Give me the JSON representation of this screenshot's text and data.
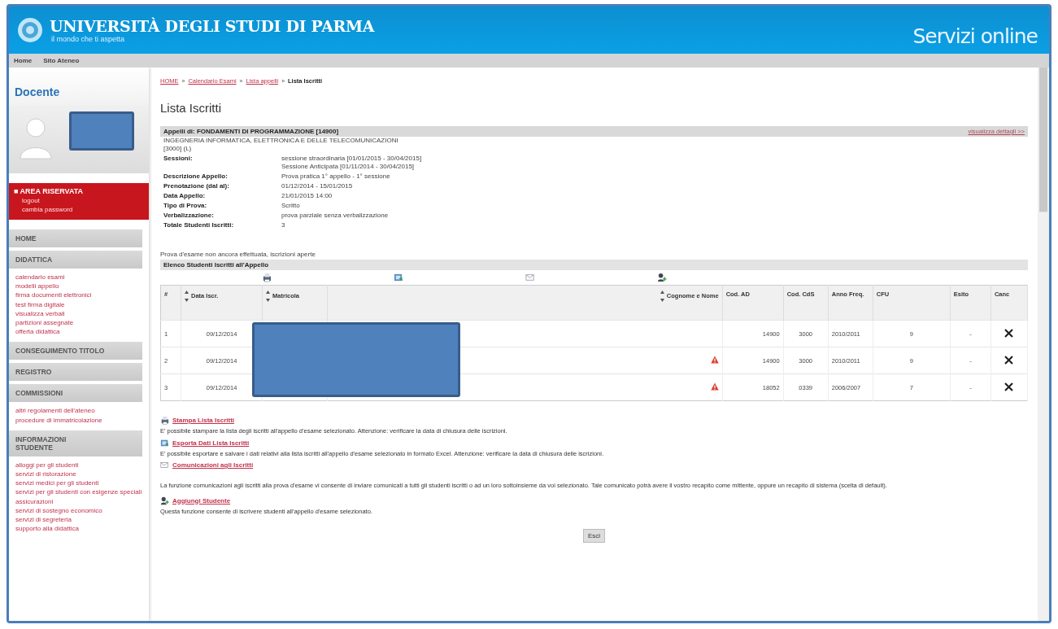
{
  "header": {
    "title": "UNIVERSITÀ DEGLI STUDI DI PARMA",
    "tagline": "il mondo che ti aspetta",
    "service": "Servizi online"
  },
  "nav": [
    "Home",
    "Sito Ateneo"
  ],
  "sidebar": {
    "title": "Docente",
    "profile": {
      "redacted": true
    },
    "reserved": {
      "bullet": "■",
      "title": "AREA RISERVATA",
      "links": [
        "logout",
        "cambia password"
      ]
    },
    "sections": [
      {
        "title": "HOME"
      },
      {
        "title": "DIDATTICA",
        "links": [
          "calendario esami",
          "modelli appello",
          "firma documenti elettronici",
          "test firma digitale",
          "visualizza verbali",
          "partizioni assegnate",
          "offerta didattica"
        ]
      },
      {
        "title": "CONSEGUIMENTO TITOLO"
      },
      {
        "title": "REGISTRO"
      },
      {
        "title": "COMMISSIONI",
        "links": [
          "altri regolamenti dell'ateneo",
          "procedure di immatricolazione"
        ]
      },
      {
        "title": "INFORMAZIONI STUDENTE",
        "links": [
          "alloggi per gli studenti",
          "servizi di ristorazione",
          "servizi medici per gli studenti",
          "servizi per gli studenti con esigenze speciali",
          "assicurazioni",
          "servizi di sostegno economico",
          "servizi di segreteria",
          "supporto alla didattica"
        ]
      }
    ]
  },
  "breadcrumb_separator": "»",
  "breadcrumb": [
    {
      "label": "HOME",
      "link": true
    },
    {
      "label": "Calendario Esami",
      "link": true
    },
    {
      "label": "Lista appelli",
      "link": true
    },
    {
      "label": "Lista Iscritti",
      "link": false
    }
  ],
  "page_title": "Lista Iscritti",
  "appello": {
    "title": "Appelli di: FONDAMENTI DI PROGRAMMAZIONE [14900]",
    "details_link": "visualizza dettagli >>",
    "course": "INGEGNERIA INFORMATICA, ELETTRONICA E DELLE TELECOMUNICAZIONI [3000] (L)",
    "fields": [
      {
        "label": "Sessioni:",
        "values": [
          "sessione straordinaria [01/01/2015 - 30/04/2015]",
          "Sessione Anticipata [01/11/2014 - 30/04/2015]"
        ]
      },
      {
        "label": "Descrizione Appello:",
        "values": [
          "Prova pratica 1° appello - 1° sessione"
        ]
      },
      {
        "label": "Prenotazione (dal al):",
        "values": [
          "01/12/2014 - 15/01/2015"
        ]
      },
      {
        "label": "Data Appello:",
        "values": [
          "21/01/2015 14:00"
        ]
      },
      {
        "label": "Tipo di Prova:",
        "values": [
          "Scritto"
        ]
      },
      {
        "label": "Verbalizzazione:",
        "values": [
          "prova parziale senza verbalizzazione"
        ]
      },
      {
        "label": "Totale Studenti Iscritti:",
        "values": [
          "3"
        ]
      }
    ]
  },
  "status_note": "Prova d'esame non ancora effettuata, iscrizioni aperte",
  "list_title": "Elenco Studenti Iscritti all'Appello",
  "toolbar": [
    {
      "kind": "print"
    },
    {
      "kind": "excel"
    },
    {
      "kind": "mail"
    },
    {
      "kind": "add"
    }
  ],
  "table": {
    "redacted": true,
    "columns": [
      {
        "label": "#",
        "sortable": false
      },
      {
        "label": "Data Iscr.",
        "sortable": true
      },
      {
        "label": "Matricola",
        "sortable": true
      },
      {
        "label": "Cognome e Nome",
        "sortable": true
      },
      {
        "label": "Cod. AD",
        "sortable": false
      },
      {
        "label": "Cod. CdS",
        "sortable": false
      },
      {
        "label": "Anno Freq.",
        "sortable": false
      },
      {
        "label": "CFU",
        "sortable": false
      },
      {
        "label": "Esito",
        "sortable": false
      },
      {
        "label": "Canc",
        "sortable": false
      }
    ],
    "rows": [
      {
        "index": "1",
        "date": "09/12/2014",
        "warning": false,
        "cod_ad": "14900",
        "cod_cds": "3000",
        "anno": "2010/2011",
        "cfu": "9",
        "esito": "-"
      },
      {
        "index": "2",
        "date": "09/12/2014",
        "warning": true,
        "cod_ad": "14900",
        "cod_cds": "3000",
        "anno": "2010/2011",
        "cfu": "9",
        "esito": "-"
      },
      {
        "index": "3",
        "date": "09/12/2014",
        "warning": true,
        "cod_ad": "18052",
        "cod_cds": "0339",
        "anno": "2006/2007",
        "cfu": "7",
        "esito": "-"
      }
    ]
  },
  "actions": [
    {
      "kind": "print",
      "label": "Stampa Lista Iscritti",
      "description": "E' possibile stampare la lista degli iscritti all'appello d'esame selezionato. Attenzione: verificare la data di chiusura delle iscrizioni."
    },
    {
      "kind": "excel",
      "label": "Esporta Dati Lista Iscritti",
      "description": "E' possibile esportare e salvare i dati relativi alla lista iscritti all'appello d'esame selezionato in formato Excel. Attenzione: verificare la data di chiusura delle iscrizioni."
    },
    {
      "kind": "mail",
      "label": "Comunicazioni agli Iscritti",
      "description": "La funzione comunicazioni agli iscritti alla prova d'esame vi consente di inviare comunicati a tutti gli studenti iscritti o ad un loro sottoinsieme da voi selezionato. Tale comunicato potrà avere il vostro recapito come mittente, oppure un recapito di sistema (scelta di default)."
    },
    {
      "kind": "add",
      "label": "Aggiungi Studente",
      "description": "Questa funzione consente di iscrivere studenti all'appello d'esame selezionato."
    }
  ],
  "exit_button": "Esci"
}
